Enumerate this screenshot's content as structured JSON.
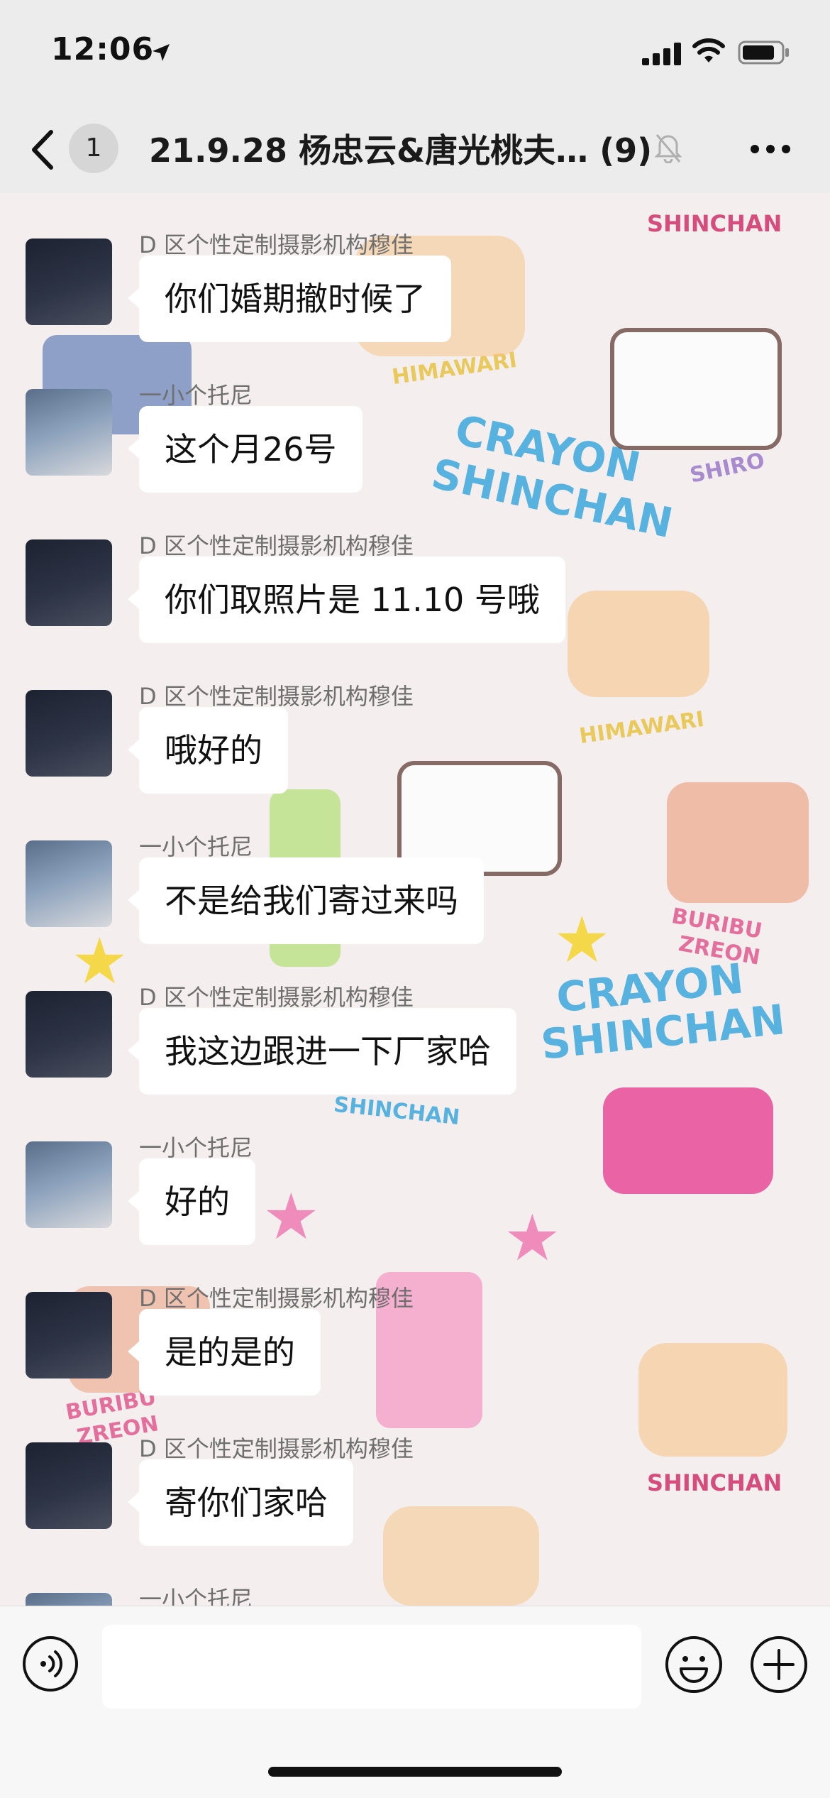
{
  "status_bar": {
    "time": "12:06"
  },
  "header": {
    "unread_count": "1",
    "title": "21.9.28 杨忠云&唐光桃夫… (9)"
  },
  "background_text": {
    "t1": "SHINCHAN",
    "t2": "HIMAWARI",
    "t3": "CRAYON",
    "t4": "SHINCHAN",
    "t5": "SHIRO",
    "t6": "HIMAWARI",
    "t7": "BURIBU",
    "t8": "ZREON",
    "t9": "CRAYON",
    "t10": "SHINCHAN",
    "t11": "SHINCHAN",
    "t12": "BURIBU",
    "t13": "ZREON",
    "t14": "SHINCHAN"
  },
  "messages": [
    {
      "sender": "D 区个性定制摄影机构穆佳",
      "text": "你们婚期撤时候了",
      "avatar": "a"
    },
    {
      "sender": "一小个托尼",
      "text": "这个月26号",
      "avatar": "b"
    },
    {
      "sender": "D 区个性定制摄影机构穆佳",
      "text": "你们取照片是 11.10 号哦",
      "avatar": "a"
    },
    {
      "sender": "D 区个性定制摄影机构穆佳",
      "text": "哦好的",
      "avatar": "a"
    },
    {
      "sender": "一小个托尼",
      "text": "不是给我们寄过来吗",
      "avatar": "b"
    },
    {
      "sender": "D 区个性定制摄影机构穆佳",
      "text": "我这边跟进一下厂家哈",
      "avatar": "a"
    },
    {
      "sender": "一小个托尼",
      "text": "好的",
      "avatar": "b"
    },
    {
      "sender": "D 区个性定制摄影机构穆佳",
      "text": "是的是的",
      "avatar": "a"
    },
    {
      "sender": "D 区个性定制摄影机构穆佳",
      "text": "寄你们家哈",
      "avatar": "a"
    },
    {
      "sender": "一小个托尼",
      "text": "",
      "avatar": "b"
    }
  ],
  "input": {
    "placeholder": ""
  },
  "colors": {
    "bubble": "#ffffff",
    "header_bg": "#ececec",
    "input_bg": "#f7f7f7"
  }
}
